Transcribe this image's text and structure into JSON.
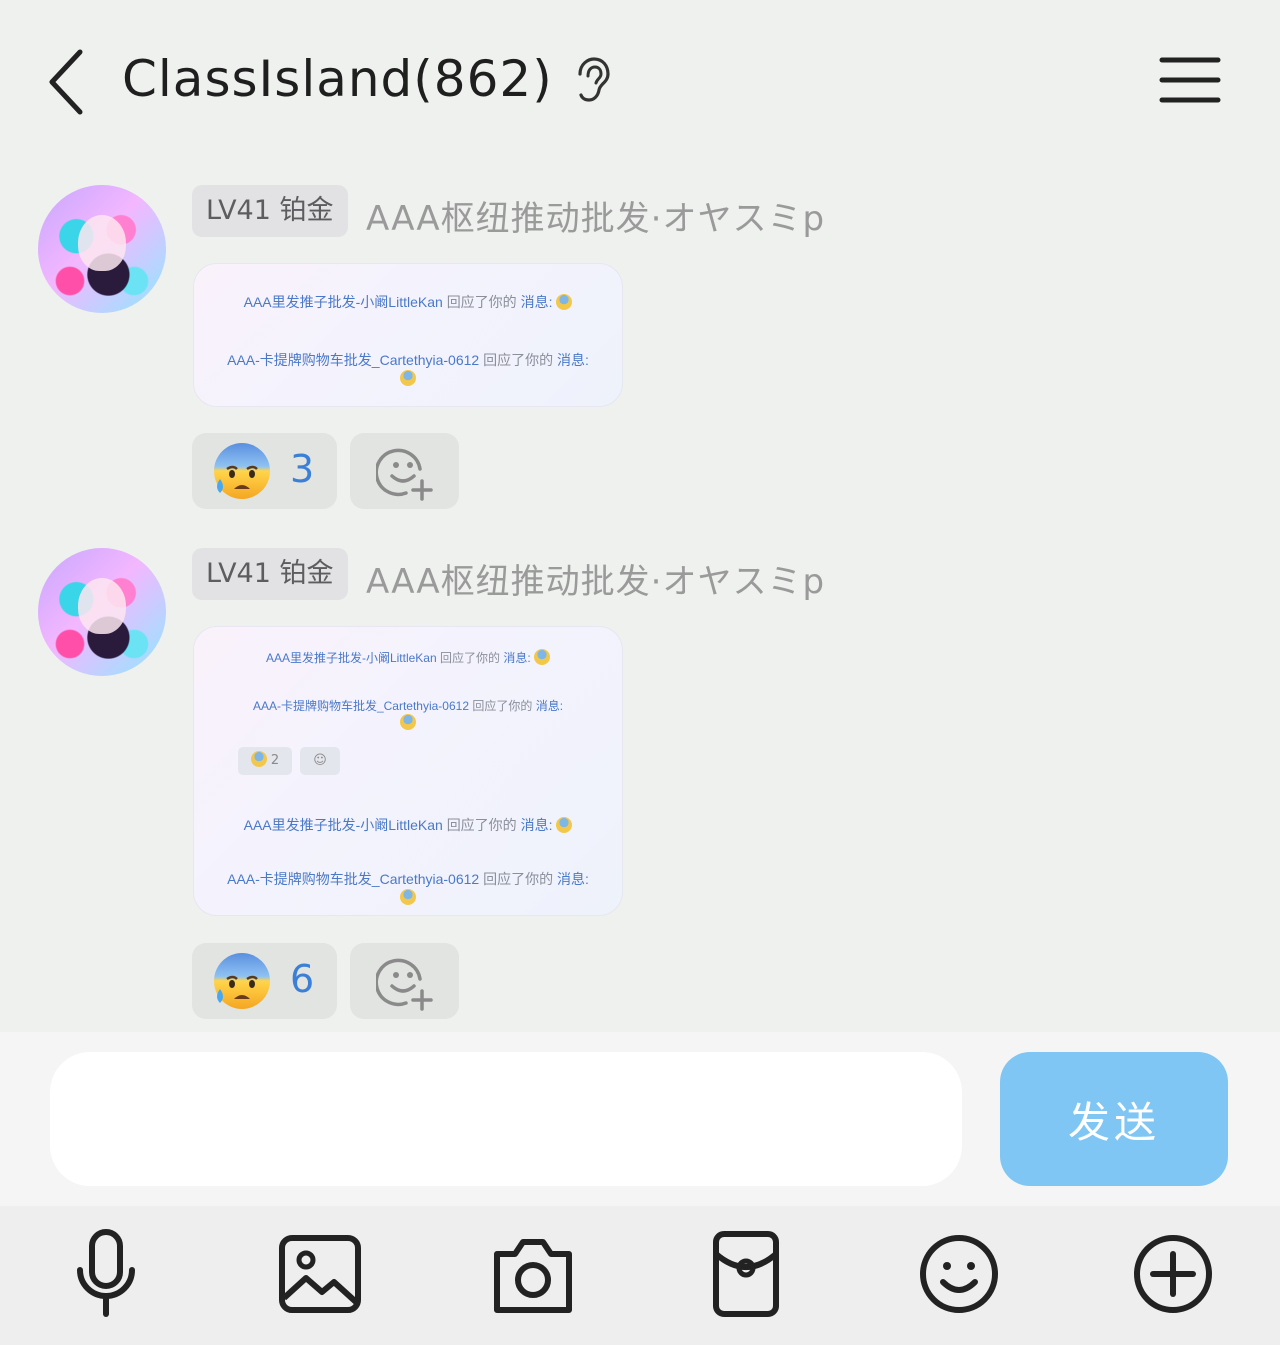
{
  "header": {
    "title": "ClassIsland(862)"
  },
  "messages": [
    {
      "level": "LV41 铂金",
      "nickname": "AAA枢纽推动批发·オヤスミp",
      "card_lines": [
        {
          "user": "AAA里发推子批发-小阚LittleKan",
          "action": "回应了你的",
          "msg": "消息:"
        },
        {
          "user": "AAA-卡提牌购物车批发_Cartethyia-0612",
          "action": "回应了你的",
          "msg": "消息:"
        }
      ],
      "reaction": {
        "emoji": "anxious-face-with-sweat",
        "count": "3"
      }
    },
    {
      "level": "LV41 铂金",
      "nickname": "AAA枢纽推动批发·オヤスミp",
      "card_lines": [
        {
          "user": "AAA里发推子批发-小阚LittleKan",
          "action": "回应了你的",
          "msg": "消息:"
        },
        {
          "user": "AAA-卡提牌购物车批发_Cartethyia-0612",
          "action": "回应了你的",
          "msg": "消息:"
        },
        {
          "user": "AAA里发推子批发-小阚LittleKan",
          "action": "回应了你的",
          "msg": "消息:"
        },
        {
          "user": "AAA-卡提牌购物车批发_Cartethyia-0612",
          "action": "回应了你的",
          "msg": "消息:"
        }
      ],
      "card_reaction_count": "2",
      "reaction": {
        "emoji": "anxious-face-with-sweat",
        "count": "6"
      }
    }
  ],
  "input": {
    "value": "",
    "send_label": "发送"
  },
  "toolbar": [
    "microphone-icon",
    "image-icon",
    "camera-icon",
    "red-packet-icon",
    "emoji-icon",
    "plus-icon"
  ],
  "colors": {
    "background": "#eef1ee",
    "send_button": "#7fc6f4",
    "count_text": "#3b7fd6"
  }
}
